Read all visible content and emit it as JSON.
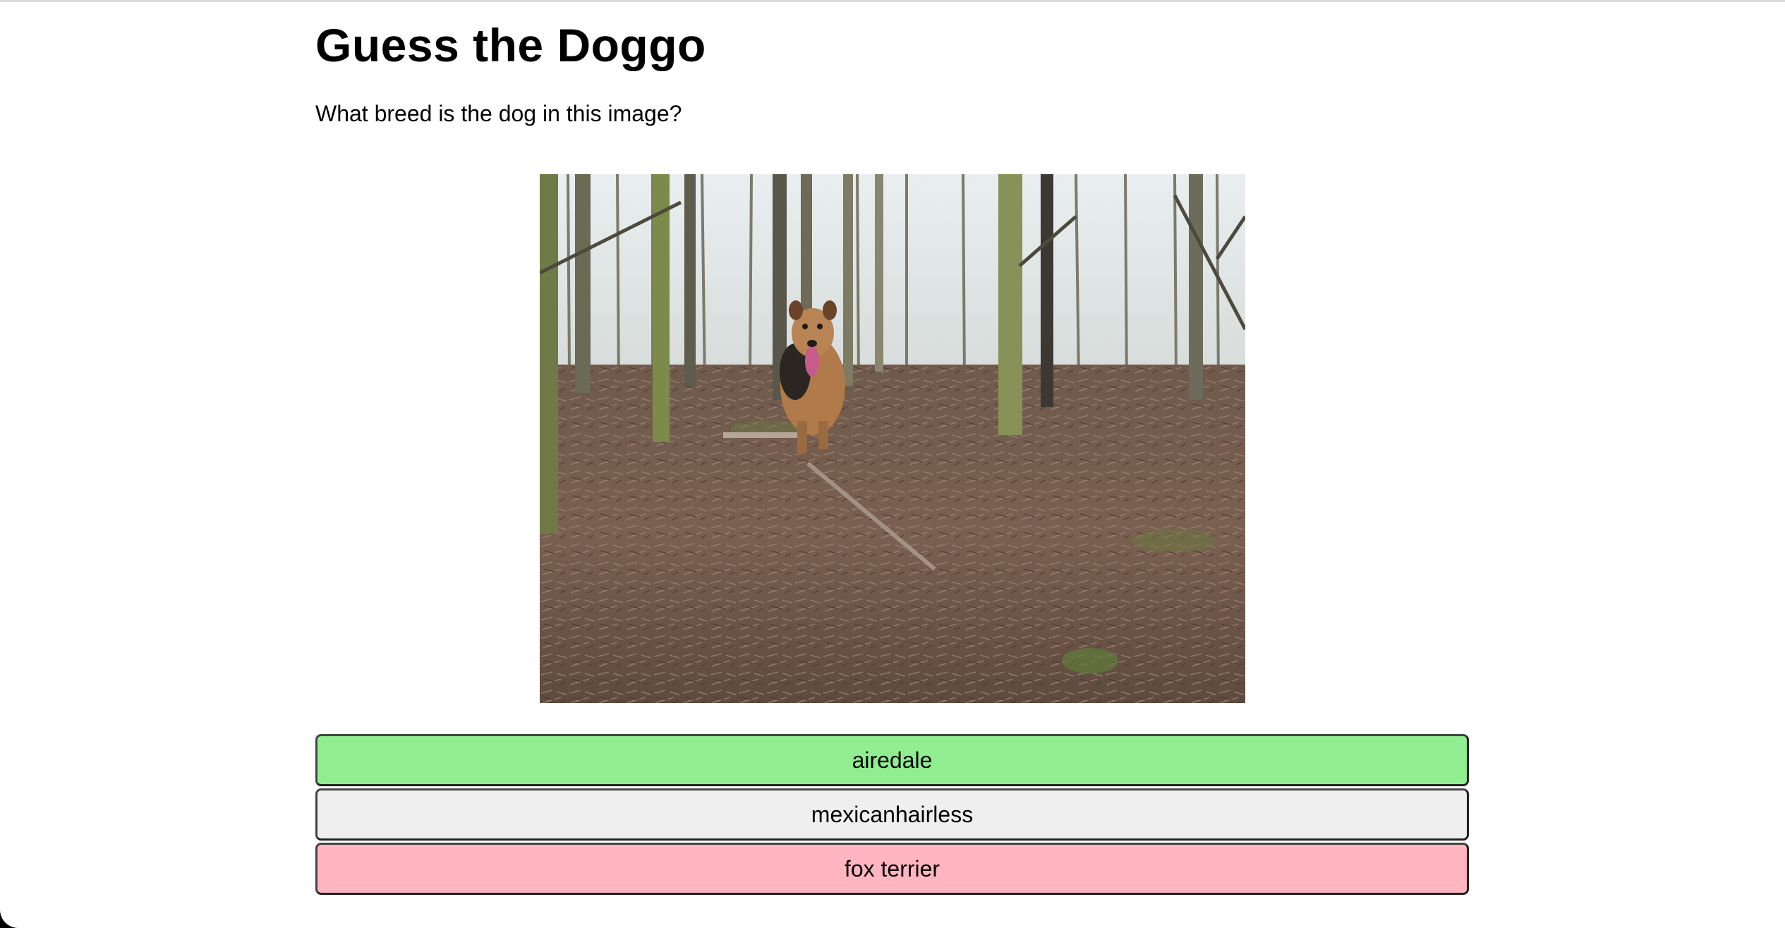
{
  "page": {
    "title": "Guess the Doggo",
    "question": "What breed is the dog in this image?"
  },
  "image": {
    "alt": "dog photo"
  },
  "choices": [
    {
      "label": "airedale",
      "state": "correct",
      "color": "#90ee90"
    },
    {
      "label": "mexicanhairless",
      "state": "neutral",
      "color": "#efefef"
    },
    {
      "label": "fox terrier",
      "state": "wrong",
      "color": "#ffb6c1"
    }
  ]
}
